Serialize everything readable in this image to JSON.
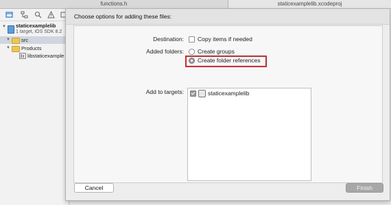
{
  "tabs": [
    "functions.h",
    "staticexamplelib.xcodeproj"
  ],
  "navigator": {
    "toolbar_icons": [
      "folder-icon",
      "hierarchy-icon",
      "search-icon",
      "warning-icon",
      "breakpoint-icon"
    ],
    "project": {
      "name": "staticexamplelib",
      "subtitle": "1 target, iOS SDK 8.2"
    },
    "items": [
      {
        "label": "src"
      },
      {
        "label": "Products"
      },
      {
        "label": "libstaticexample"
      }
    ]
  },
  "dialog": {
    "title": "Choose options for adding these files:",
    "destination_label": "Destination:",
    "copy_items_label": "Copy items if needed",
    "copy_items_checked": false,
    "added_folders_label": "Added folders:",
    "create_groups_label": "Create groups",
    "create_folder_refs_label": "Create folder references",
    "selected_folder_option": "Create folder references",
    "add_to_targets_label": "Add to targets:",
    "targets": [
      {
        "name": "staticexamplelib",
        "checked": true
      }
    ],
    "cancel_label": "Cancel",
    "finish_label": "Finish"
  },
  "colors": {
    "highlight": "#e0262a",
    "accent": "#2e6fb3"
  }
}
